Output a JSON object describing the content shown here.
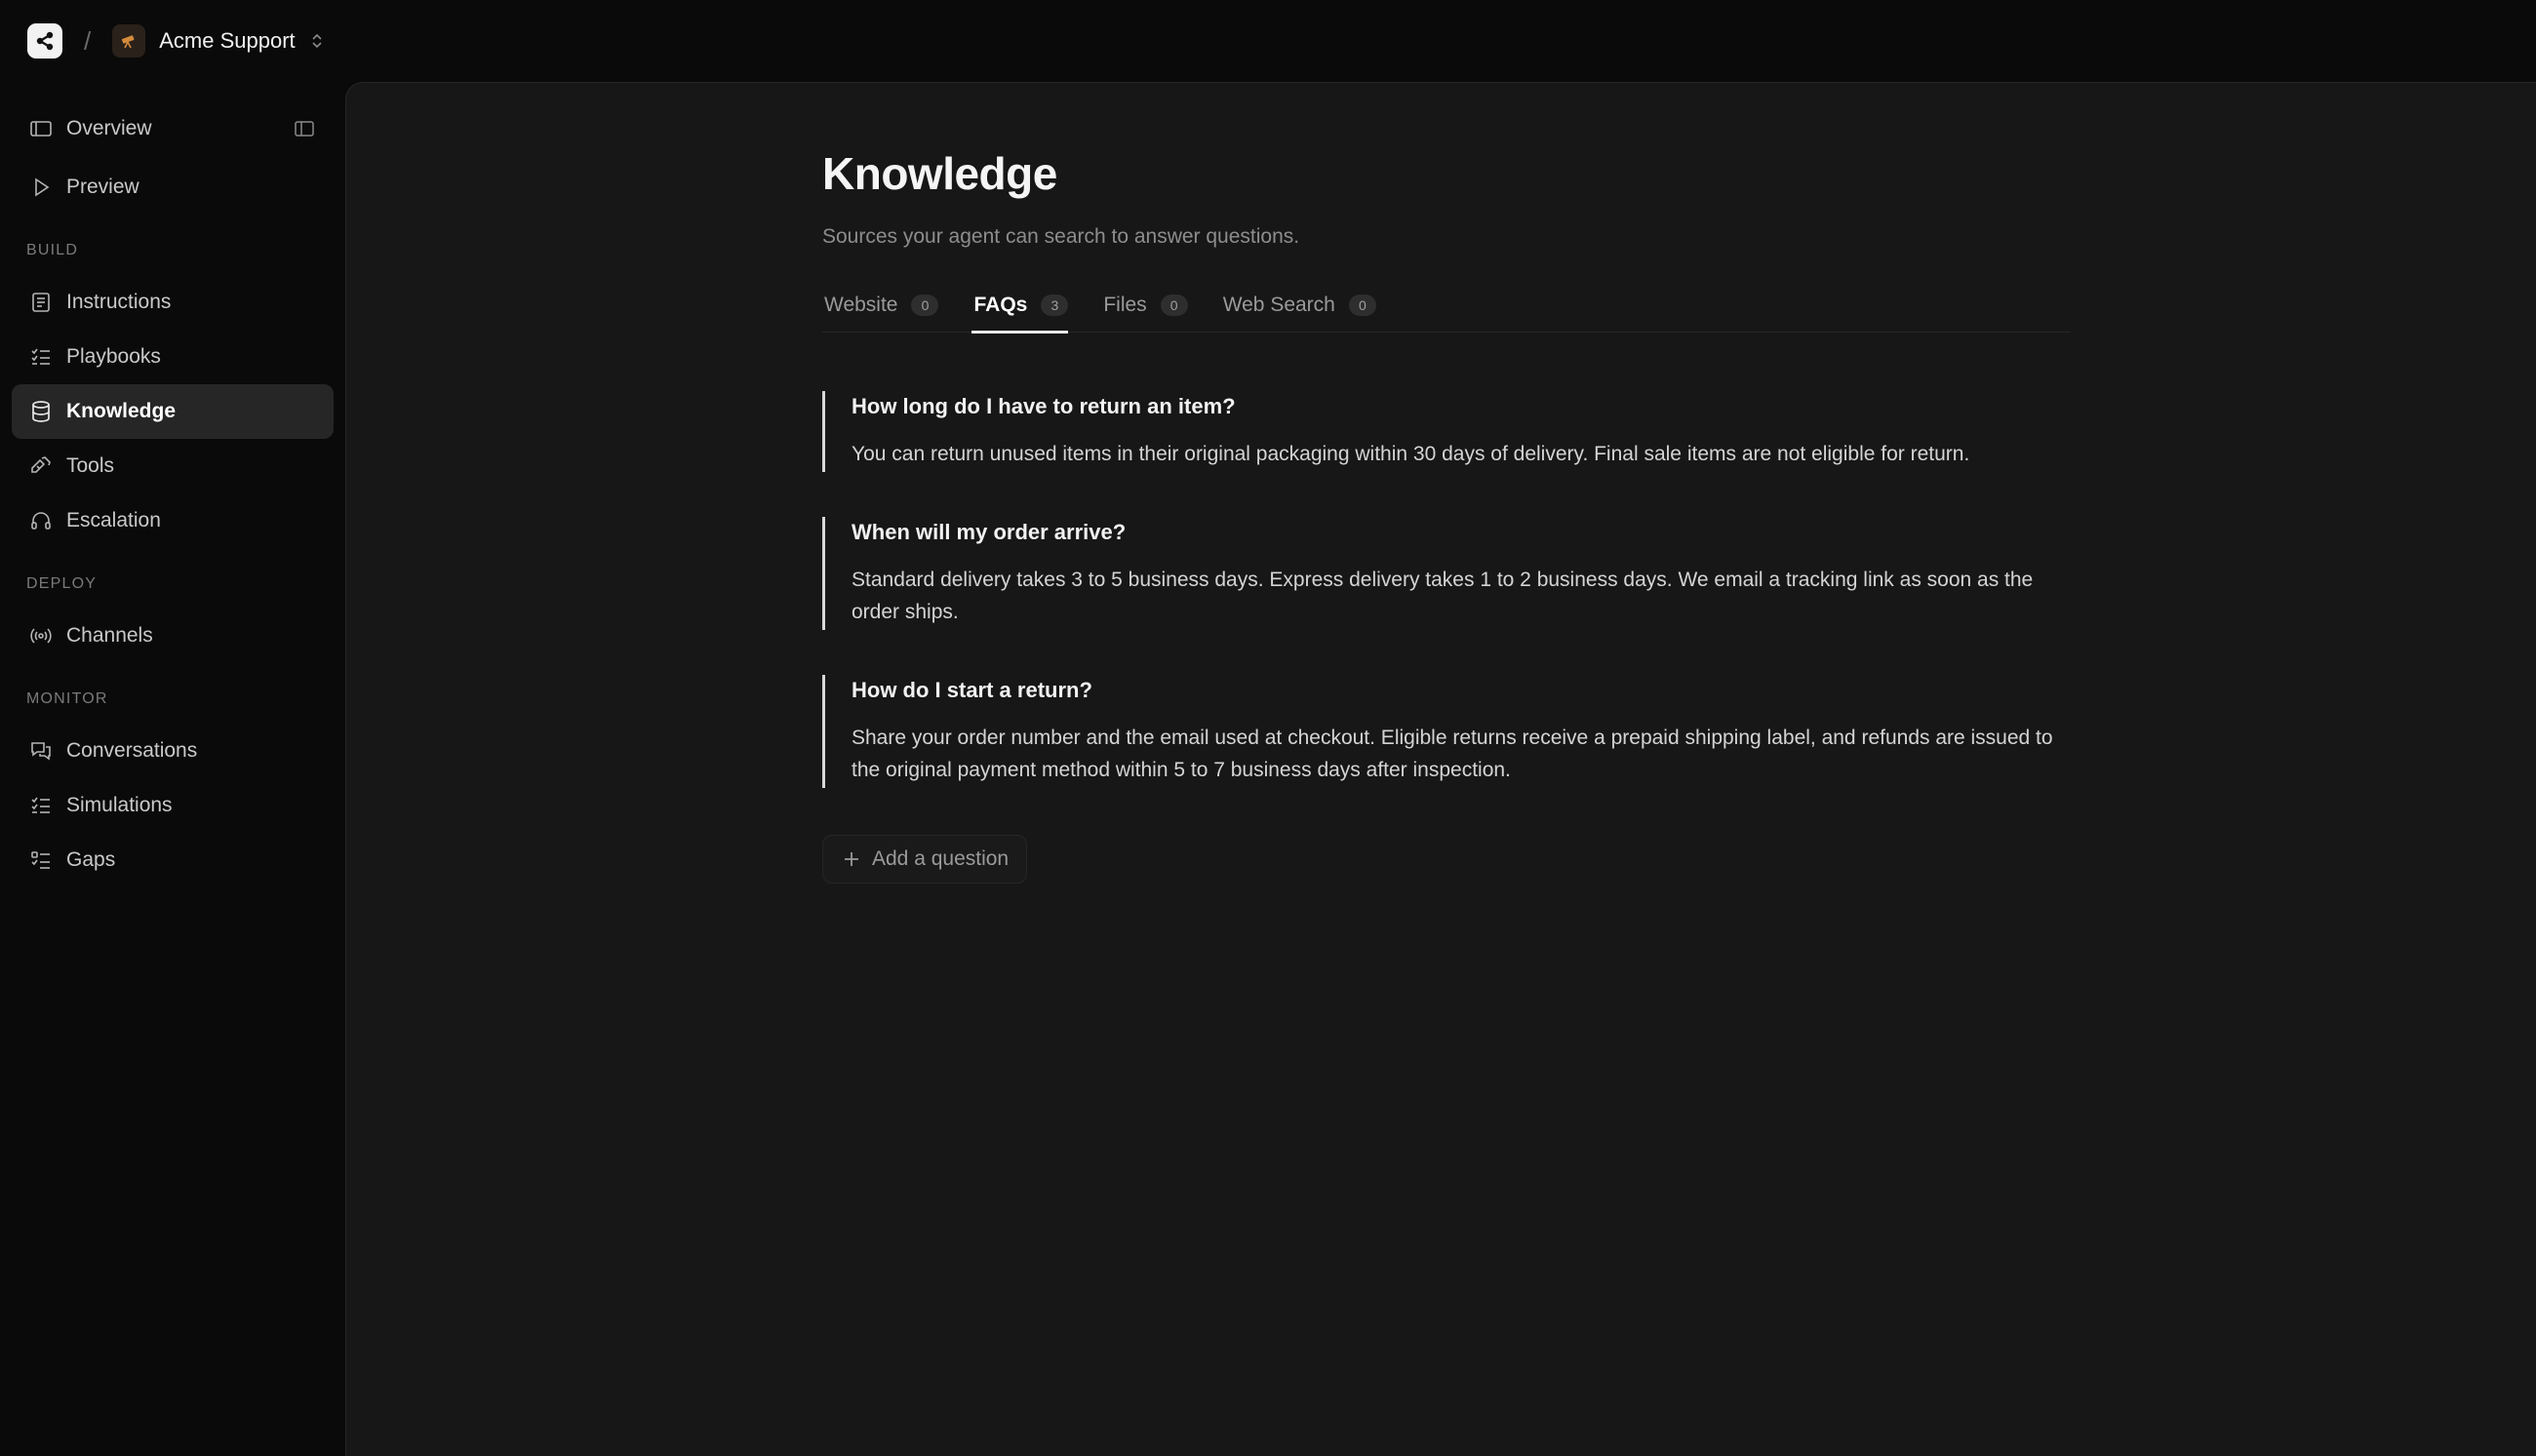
{
  "topbar": {
    "workspace_name": "Acme Support",
    "separator": "/"
  },
  "sidebar": {
    "top_items": [
      {
        "label": "Overview",
        "icon": "layout-icon"
      },
      {
        "label": "Preview",
        "icon": "play-icon"
      }
    ],
    "sections": [
      {
        "label": "BUILD",
        "items": [
          {
            "label": "Instructions",
            "icon": "instructions-icon"
          },
          {
            "label": "Playbooks",
            "icon": "checklist-icon"
          },
          {
            "label": "Knowledge",
            "icon": "database-icon",
            "active": true
          },
          {
            "label": "Tools",
            "icon": "tools-icon"
          },
          {
            "label": "Escalation",
            "icon": "headset-icon"
          }
        ]
      },
      {
        "label": "DEPLOY",
        "items": [
          {
            "label": "Channels",
            "icon": "broadcast-icon"
          }
        ]
      },
      {
        "label": "MONITOR",
        "items": [
          {
            "label": "Conversations",
            "icon": "chat-icon"
          },
          {
            "label": "Simulations",
            "icon": "checklist-icon"
          },
          {
            "label": "Gaps",
            "icon": "list-check-icon"
          }
        ]
      }
    ]
  },
  "page": {
    "title": "Knowledge",
    "subtitle": "Sources your agent can search to answer questions."
  },
  "tabs": [
    {
      "label": "Website",
      "count": "0"
    },
    {
      "label": "FAQs",
      "count": "3",
      "active": true
    },
    {
      "label": "Files",
      "count": "0"
    },
    {
      "label": "Web Search",
      "count": "0"
    }
  ],
  "faqs": [
    {
      "question": "How long do I have to return an item?",
      "answer": "You can return unused items in their original packaging within 30 days of delivery. Final sale items are not eligible for return."
    },
    {
      "question": "When will my order arrive?",
      "answer": "Standard delivery takes 3 to 5 business days. Express delivery takes 1 to 2 business days. We email a tracking link as soon as the order ships."
    },
    {
      "question": "How do I start a return?",
      "answer": "Share your order number and the email used at checkout. Eligible returns receive a prepaid shipping label, and refunds are issued to the original payment method within 5 to 7 business days after inspection."
    }
  ],
  "add_button_label": "Add a question",
  "colors": {
    "background": "#0a0a0a",
    "main_panel": "#171717",
    "active_nav": "#262626",
    "accent_border": "#d8d8d8"
  }
}
